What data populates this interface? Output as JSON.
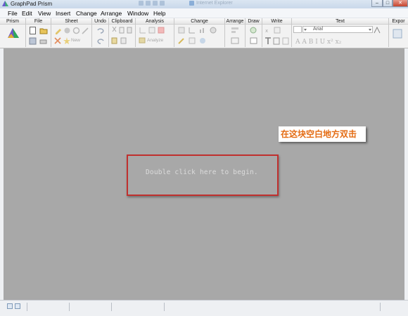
{
  "window": {
    "title": "GraphPad Prism",
    "background_task": "Internet Explorer",
    "controls": {
      "minimize": "–",
      "maximize": "□",
      "close": "✕"
    }
  },
  "menu": [
    "File",
    "Edit",
    "View",
    "Insert",
    "Change",
    "Arrange",
    "Window",
    "Help"
  ],
  "toolbar": {
    "groups": [
      "Prism",
      "File",
      "Sheet",
      "Undo",
      "Clipboard",
      "Analysis",
      "Change",
      "Arrange",
      "Draw",
      "Write",
      "Text",
      "Expor"
    ],
    "sheet_new_label": "New",
    "analyze_label": "Analyze",
    "font_value": "Arial"
  },
  "workspace": {
    "hint": "Double click here to begin.",
    "callout": "在这块空白地方双击",
    "highlight_color": "#c0302e",
    "callout_color": "#e46b12"
  }
}
